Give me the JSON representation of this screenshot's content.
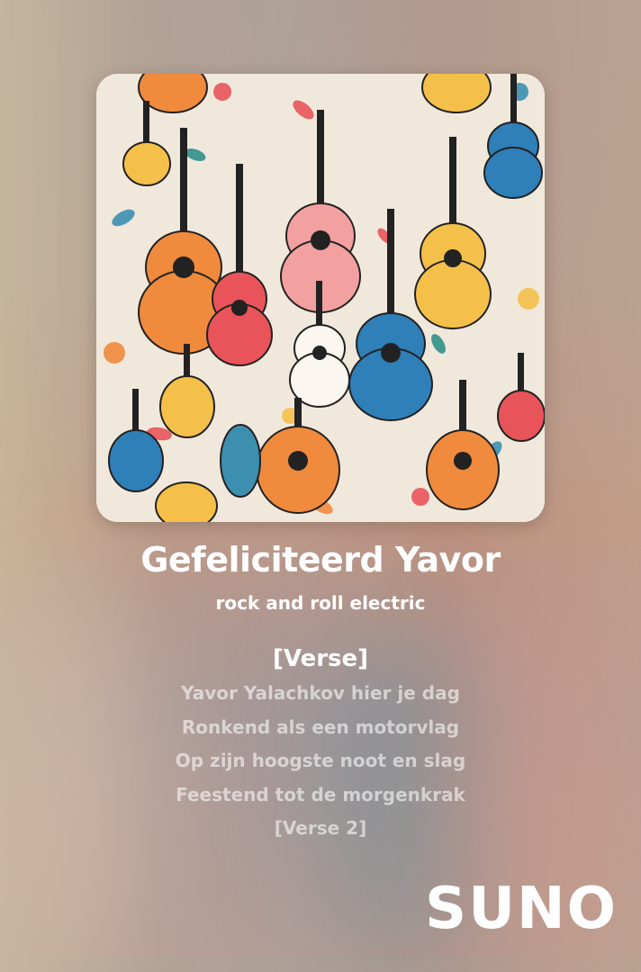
{
  "song": {
    "title": "Gefeliciteerd Yavor",
    "style": "rock and roll electric"
  },
  "lyrics": {
    "heading": "[Verse]",
    "lines": [
      "Yavor Yalachkov hier je dag",
      "Ronkend als een motorvlag",
      "Op zijn hoogste noot en slag",
      "Feestend tot de morgenkrak",
      "[Verse 2]"
    ]
  },
  "brand": {
    "logo_text": "SUNO"
  },
  "colors": {
    "text": "#ffffff",
    "cover_background": "#f1e8dc",
    "guitar_orange": "#f08a3c",
    "guitar_yellow": "#f5c04a",
    "guitar_blue": "#2f7fb8",
    "guitar_red": "#e8545a"
  }
}
